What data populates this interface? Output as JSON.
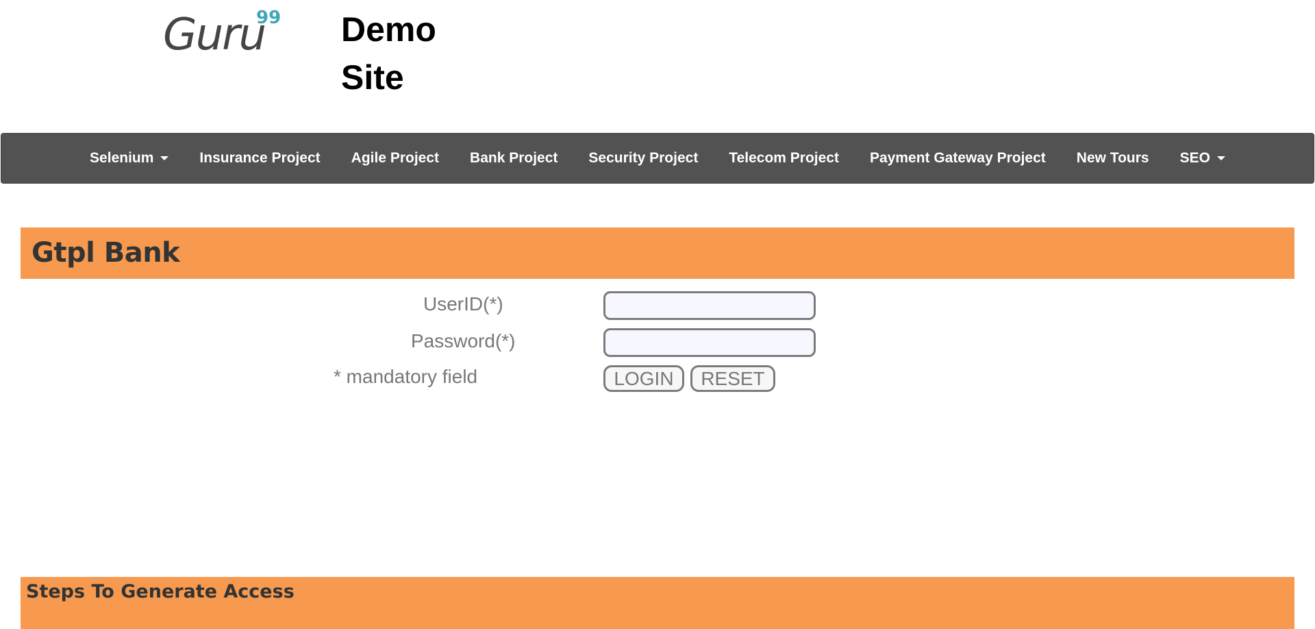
{
  "header": {
    "logo_text": "Guru",
    "logo_superscript": "99",
    "site_title_line1": "Demo",
    "site_title_line2": "Site"
  },
  "nav": {
    "items": [
      {
        "label": "Selenium",
        "dropdown": true
      },
      {
        "label": "Insurance Project",
        "dropdown": false
      },
      {
        "label": "Agile Project",
        "dropdown": false
      },
      {
        "label": "Bank Project",
        "dropdown": false
      },
      {
        "label": "Security Project",
        "dropdown": false
      },
      {
        "label": "Telecom Project",
        "dropdown": false
      },
      {
        "label": "Payment Gateway Project",
        "dropdown": false
      },
      {
        "label": "New Tours",
        "dropdown": false
      },
      {
        "label": "SEO",
        "dropdown": true
      }
    ]
  },
  "bank": {
    "title": "Gtpl Bank"
  },
  "login_form": {
    "userid_label": "UserID(*)",
    "userid_value": "",
    "password_label": "Password(*)",
    "password_value": "",
    "mandatory_note": "* mandatory field",
    "login_button": "LOGIN",
    "reset_button": "RESET"
  },
  "steps": {
    "title": "Steps To Generate Access"
  },
  "colors": {
    "nav_background": "#525252",
    "banner_orange": "#f79a4f",
    "logo_gray": "#454545",
    "logo_teal": "#3fa7b8"
  }
}
